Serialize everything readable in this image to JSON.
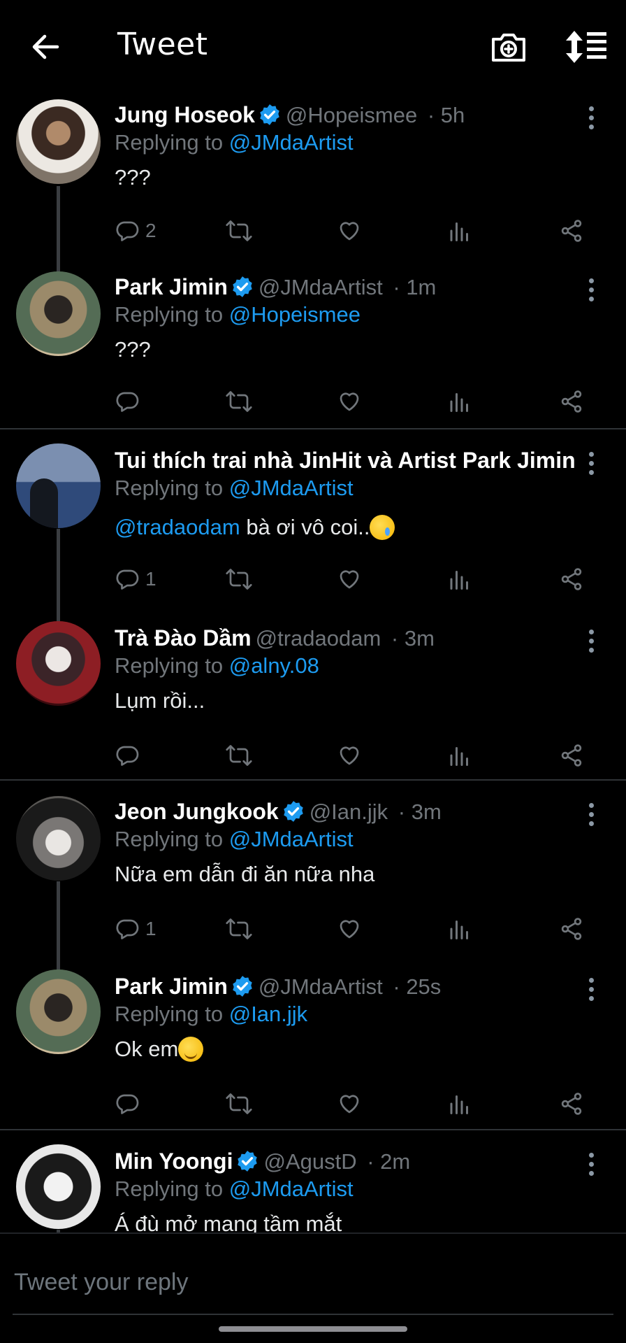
{
  "header": {
    "title": "Tweet",
    "back_icon": "arrow-left-icon",
    "camera_icon": "camera-plus-icon",
    "sort_icon": "sort-list-icon"
  },
  "colors": {
    "background": "#000000",
    "accent": "#1d9bf0",
    "secondary_text": "#71767b",
    "divider": "#2f3336"
  },
  "tweets": [
    {
      "name": "Jung Hoseok",
      "verified": true,
      "handle": "@Hopeismee",
      "time": "5h",
      "replying_prefix": "Replying to",
      "replying_to": "@JMdaArtist",
      "text": "???",
      "reply_count": "2"
    },
    {
      "name": "Park Jimin",
      "verified": true,
      "handle": "@JMdaArtist",
      "time": "1m",
      "replying_prefix": "Replying to",
      "replying_to": "@Hopeismee",
      "text": "???",
      "reply_count": ""
    },
    {
      "name": "Tui thích trai nhà JinHit và Artist Park Jimin",
      "verified": false,
      "handle": "",
      "time": "",
      "replying_prefix": "Replying to",
      "replying_to": "@JMdaArtist",
      "text_mention": "@tradaodam",
      "text": "bà ơi vô coi..",
      "reply_count": "1"
    },
    {
      "name": "Trà Đào Dầm",
      "verified": false,
      "handle": "@tradaodam",
      "time": "3m",
      "replying_prefix": "Replying to",
      "replying_to": "@alny.08",
      "text": "Lụm rồi...",
      "reply_count": ""
    },
    {
      "name": "Jeon Jungkook",
      "verified": true,
      "handle": "@Ian.jjk",
      "time": "3m",
      "replying_prefix": "Replying to",
      "replying_to": "@JMdaArtist",
      "text": "Nữa em dẫn đi ăn nữa nha",
      "reply_count": "1"
    },
    {
      "name": "Park Jimin",
      "verified": true,
      "handle": "@JMdaArtist",
      "time": "25s",
      "replying_prefix": "Replying to",
      "replying_to": "@Ian.jjk",
      "text": "Ok em",
      "reply_count": ""
    },
    {
      "name": "Min Yoongi",
      "verified": true,
      "handle": "@AgustD",
      "time": "2m",
      "replying_prefix": "Replying to",
      "replying_to": "@JMdaArtist",
      "text": "Á đù mở mang tầm mắt",
      "reply_count": ""
    }
  ],
  "reply_bar": {
    "placeholder": "Tweet your reply"
  }
}
